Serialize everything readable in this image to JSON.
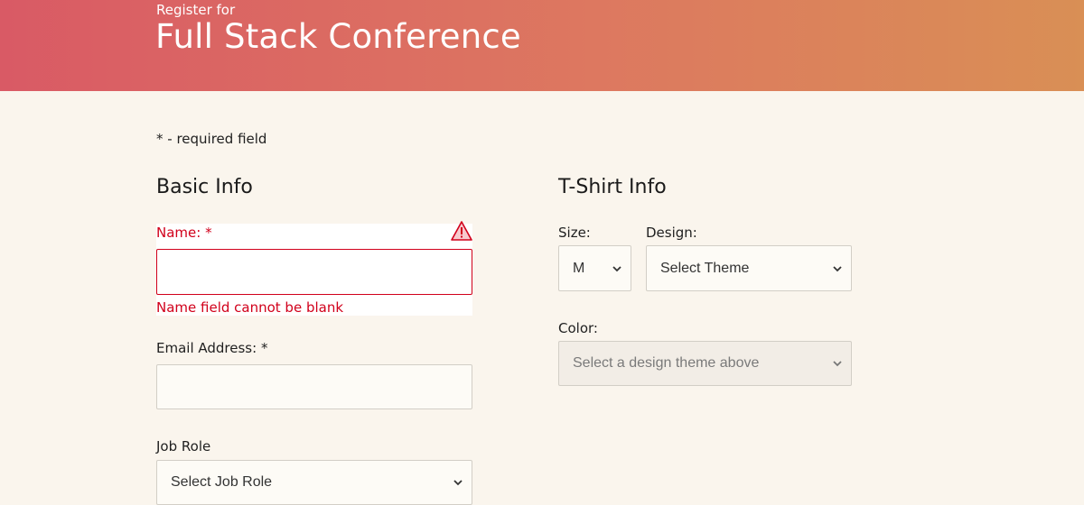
{
  "header": {
    "subtitle": "Register for",
    "title": "Full Stack Conference"
  },
  "required_note": "* - required field",
  "basic_info": {
    "title": "Basic Info",
    "name_label": "Name: *",
    "name_value": "",
    "name_error": "Name field cannot be blank",
    "email_label": "Email Address: *",
    "email_value": "",
    "job_role_label": "Job Role",
    "job_role_selected": "Select Job Role"
  },
  "tshirt_info": {
    "title": "T-Shirt Info",
    "size_label": "Size:",
    "size_selected": "M",
    "design_label": "Design:",
    "design_selected": "Select Theme",
    "color_label": "Color:",
    "color_selected": "Select a design theme above"
  },
  "colors": {
    "error": "#d1001b",
    "background": "#faf5ed",
    "header_gradient_start": "#d95a65",
    "header_gradient_end": "#d98f55"
  },
  "icons": {
    "warning": "warning-triangle-icon",
    "chevron": "chevron-down-icon"
  }
}
